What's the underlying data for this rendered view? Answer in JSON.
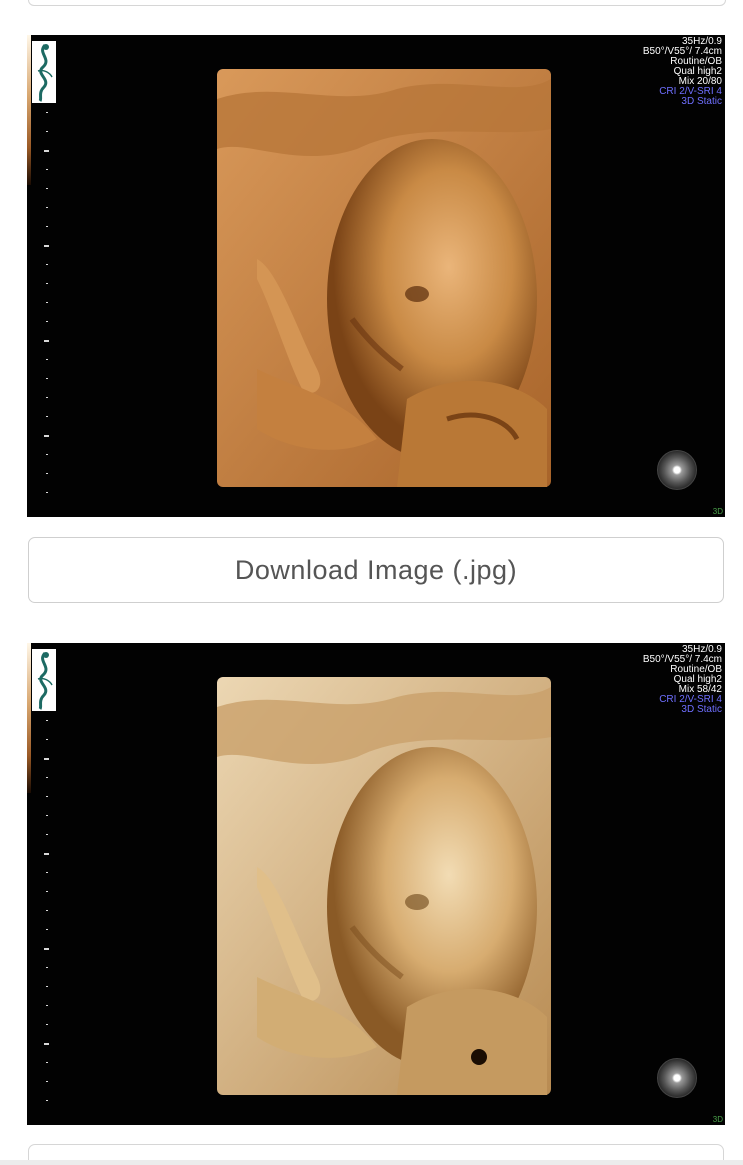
{
  "images": [
    {
      "readout": {
        "line1": "35Hz/0.9",
        "line2": "B50°/V55°/ 7.4cm",
        "line3": "Routine/OB",
        "line4": "Qual high2",
        "line5": "Mix 20/80",
        "line6": "CRI 2/V-SRI 4",
        "line7": "3D Static"
      },
      "corner_label": "3D"
    },
    {
      "readout": {
        "line1": "35Hz/0.9",
        "line2": "B50°/V55°/ 7.4cm",
        "line3": "Routine/OB",
        "line4": "Qual high2",
        "line5": "Mix 58/42",
        "line6": "CRI 2/V-SRI 4",
        "line7": "3D Static"
      },
      "corner_label": "3D"
    }
  ],
  "download_button": {
    "label": "Download Image (.jpg)"
  },
  "colors": {
    "background": "#ffffff",
    "scan_background": "#020202",
    "readout_text": "#ffffff",
    "readout_accent": "#6f6fff",
    "render_tone_warm": "#c98a45",
    "render_tone_light": "#e8c896",
    "button_text": "#555555",
    "button_border": "#cfcfcf"
  },
  "icons": [
    "clinic-logo-icon",
    "render-light-orb-icon"
  ]
}
